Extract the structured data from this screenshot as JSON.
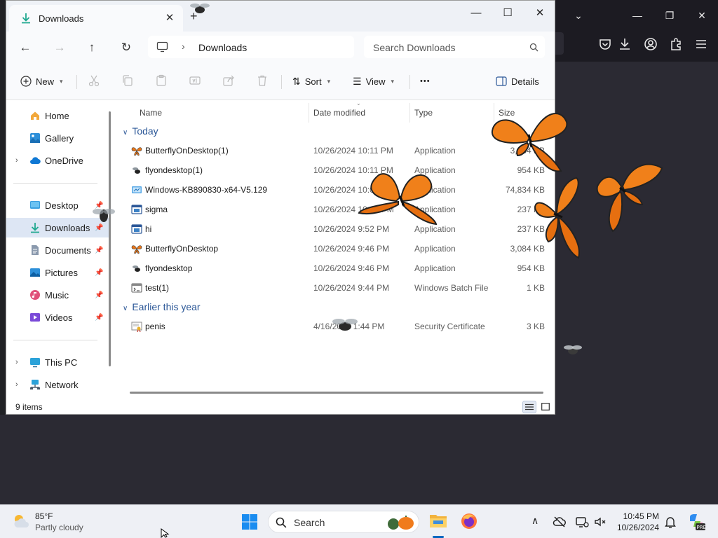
{
  "explorer": {
    "tab_title": "Downloads",
    "tab_close": "✕",
    "tab_new": "+",
    "window_controls": {
      "minimize": "—",
      "maximize": "☐",
      "close": "✕"
    },
    "breadcrumb": "Downloads",
    "search_placeholder": "Search Downloads",
    "commands": {
      "new": "New",
      "sort": "Sort",
      "view": "View",
      "more": "•••",
      "details": "Details"
    },
    "columns": {
      "name": "Name",
      "date": "Date modified",
      "type": "Type",
      "size": "Size"
    },
    "nav": {
      "home": "Home",
      "gallery": "Gallery",
      "onedrive": "OneDrive",
      "desktop": "Desktop",
      "downloads": "Downloads",
      "documents": "Documents",
      "pictures": "Pictures",
      "music": "Music",
      "videos": "Videos",
      "thispc": "This PC",
      "network": "Network"
    },
    "groups": {
      "today": "Today",
      "earlier": "Earlier this year"
    },
    "files": [
      {
        "name": "ButterflyOnDesktop(1)",
        "date": "10/26/2024 10:11 PM",
        "type": "Application",
        "size": "3,084 KB",
        "icon": "butterfly-icon"
      },
      {
        "name": "flyondesktop(1)",
        "date": "10/26/2024 10:11 PM",
        "type": "Application",
        "size": "954 KB",
        "icon": "fly-icon"
      },
      {
        "name": "Windows-KB890830-x64-V5.129",
        "date": "10/26/2024 10:08 PM",
        "type": "Application",
        "size": "74,834 KB",
        "icon": "installer-icon"
      },
      {
        "name": "sigma",
        "date": "10/26/2024 10:03 PM",
        "type": "Application",
        "size": "237 KB",
        "icon": "app-window-icon"
      },
      {
        "name": "hi",
        "date": "10/26/2024 9:52 PM",
        "type": "Application",
        "size": "237 KB",
        "icon": "app-window-icon"
      },
      {
        "name": "ButterflyOnDesktop",
        "date": "10/26/2024 9:46 PM",
        "type": "Application",
        "size": "3,084 KB",
        "icon": "butterfly-icon"
      },
      {
        "name": "flyondesktop",
        "date": "10/26/2024 9:46 PM",
        "type": "Application",
        "size": "954 KB",
        "icon": "fly-icon"
      },
      {
        "name": "test(1)",
        "date": "10/26/2024 9:44 PM",
        "type": "Windows Batch File",
        "size": "1 KB",
        "icon": "batch-file-icon"
      }
    ],
    "earlier_files": [
      {
        "name": "penis",
        "date": "4/16/2024 1:44 PM",
        "type": "Security Certificate",
        "size": "3 KB",
        "icon": "certificate-icon"
      }
    ],
    "status": "9 items"
  },
  "taskbar": {
    "weather_temp": "85°F",
    "weather_desc": "Partly cloudy",
    "search_label": "Search",
    "time": "10:45 PM",
    "date": "10/26/2024"
  },
  "colors": {
    "accent": "#0067c0",
    "group_heading": "#2b5797",
    "selection": "#dde6f4",
    "desktop_bg": "#2b2a33"
  }
}
